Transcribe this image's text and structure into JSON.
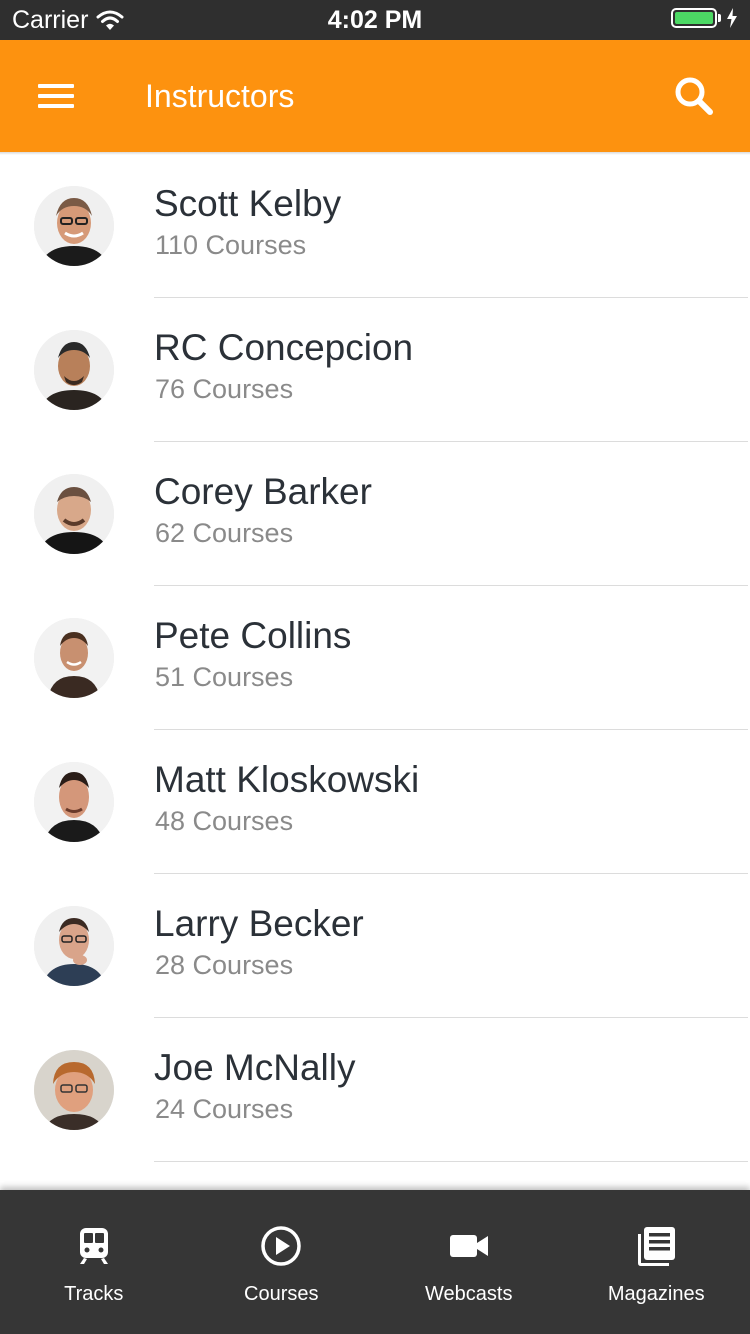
{
  "status_bar": {
    "carrier": "Carrier",
    "time": "4:02 PM",
    "battery_level": 1.0,
    "battery_color": "#4cd964"
  },
  "app_bar": {
    "title": "Instructors",
    "color": "#fd920f",
    "menu_icon": "hamburger-menu-icon",
    "search_icon": "search-icon"
  },
  "instructors": [
    {
      "name": "Scott Kelby",
      "courses": "110 Courses"
    },
    {
      "name": "RC Concepcion",
      "courses": "76 Courses"
    },
    {
      "name": "Corey Barker",
      "courses": "62 Courses"
    },
    {
      "name": "Pete Collins",
      "courses": "51 Courses"
    },
    {
      "name": "Matt Kloskowski",
      "courses": "48 Courses"
    },
    {
      "name": "Larry Becker",
      "courses": "28 Courses"
    },
    {
      "name": "Joe McNally",
      "courses": "24 Courses"
    }
  ],
  "tab_bar": {
    "tabs": [
      {
        "label": "Tracks",
        "icon": "train-icon"
      },
      {
        "label": "Courses",
        "icon": "play-circle-icon"
      },
      {
        "label": "Webcasts",
        "icon": "video-camera-icon"
      },
      {
        "label": "Magazines",
        "icon": "newspaper-icon"
      }
    ]
  }
}
